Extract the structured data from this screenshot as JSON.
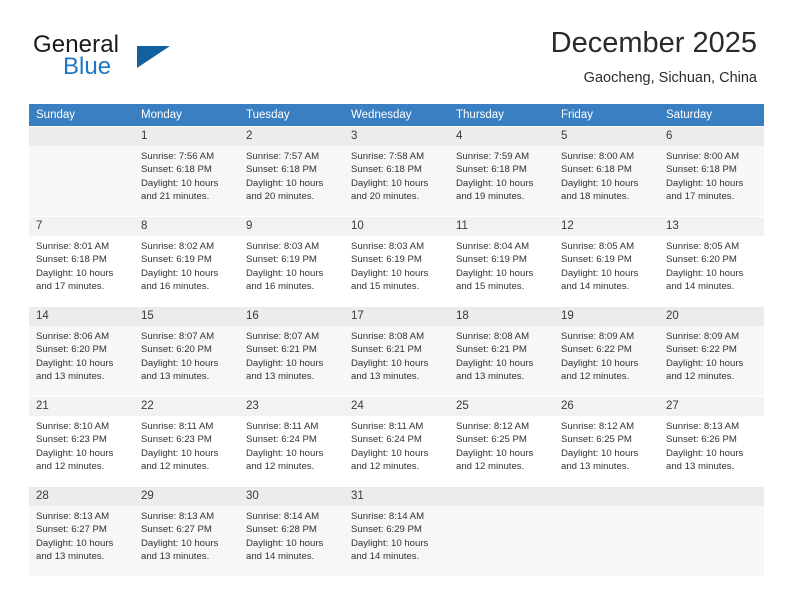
{
  "brand": {
    "name_part1": "General",
    "name_part2": "Blue",
    "logo_icon": "triangle-mark"
  },
  "header": {
    "title": "December 2025",
    "subtitle": "Gaocheng, Sichuan, China"
  },
  "weekdays": [
    "Sunday",
    "Monday",
    "Tuesday",
    "Wednesday",
    "Thursday",
    "Friday",
    "Saturday"
  ],
  "colors": {
    "header_blue": "#3a7fc1",
    "logo_blue": "#1f77c4",
    "daynum_bg": "#f2f2f2",
    "row_shade": "#f7f7f7",
    "text": "#333333"
  },
  "weeks": [
    [
      {
        "day": "",
        "detail": ""
      },
      {
        "day": "1",
        "detail": "Sunrise: 7:56 AM\nSunset: 6:18 PM\nDaylight: 10 hours\nand 21 minutes."
      },
      {
        "day": "2",
        "detail": "Sunrise: 7:57 AM\nSunset: 6:18 PM\nDaylight: 10 hours\nand 20 minutes."
      },
      {
        "day": "3",
        "detail": "Sunrise: 7:58 AM\nSunset: 6:18 PM\nDaylight: 10 hours\nand 20 minutes."
      },
      {
        "day": "4",
        "detail": "Sunrise: 7:59 AM\nSunset: 6:18 PM\nDaylight: 10 hours\nand 19 minutes."
      },
      {
        "day": "5",
        "detail": "Sunrise: 8:00 AM\nSunset: 6:18 PM\nDaylight: 10 hours\nand 18 minutes."
      },
      {
        "day": "6",
        "detail": "Sunrise: 8:00 AM\nSunset: 6:18 PM\nDaylight: 10 hours\nand 17 minutes."
      }
    ],
    [
      {
        "day": "7",
        "detail": "Sunrise: 8:01 AM\nSunset: 6:18 PM\nDaylight: 10 hours\nand 17 minutes."
      },
      {
        "day": "8",
        "detail": "Sunrise: 8:02 AM\nSunset: 6:19 PM\nDaylight: 10 hours\nand 16 minutes."
      },
      {
        "day": "9",
        "detail": "Sunrise: 8:03 AM\nSunset: 6:19 PM\nDaylight: 10 hours\nand 16 minutes."
      },
      {
        "day": "10",
        "detail": "Sunrise: 8:03 AM\nSunset: 6:19 PM\nDaylight: 10 hours\nand 15 minutes."
      },
      {
        "day": "11",
        "detail": "Sunrise: 8:04 AM\nSunset: 6:19 PM\nDaylight: 10 hours\nand 15 minutes."
      },
      {
        "day": "12",
        "detail": "Sunrise: 8:05 AM\nSunset: 6:19 PM\nDaylight: 10 hours\nand 14 minutes."
      },
      {
        "day": "13",
        "detail": "Sunrise: 8:05 AM\nSunset: 6:20 PM\nDaylight: 10 hours\nand 14 minutes."
      }
    ],
    [
      {
        "day": "14",
        "detail": "Sunrise: 8:06 AM\nSunset: 6:20 PM\nDaylight: 10 hours\nand 13 minutes."
      },
      {
        "day": "15",
        "detail": "Sunrise: 8:07 AM\nSunset: 6:20 PM\nDaylight: 10 hours\nand 13 minutes."
      },
      {
        "day": "16",
        "detail": "Sunrise: 8:07 AM\nSunset: 6:21 PM\nDaylight: 10 hours\nand 13 minutes."
      },
      {
        "day": "17",
        "detail": "Sunrise: 8:08 AM\nSunset: 6:21 PM\nDaylight: 10 hours\nand 13 minutes."
      },
      {
        "day": "18",
        "detail": "Sunrise: 8:08 AM\nSunset: 6:21 PM\nDaylight: 10 hours\nand 13 minutes."
      },
      {
        "day": "19",
        "detail": "Sunrise: 8:09 AM\nSunset: 6:22 PM\nDaylight: 10 hours\nand 12 minutes."
      },
      {
        "day": "20",
        "detail": "Sunrise: 8:09 AM\nSunset: 6:22 PM\nDaylight: 10 hours\nand 12 minutes."
      }
    ],
    [
      {
        "day": "21",
        "detail": "Sunrise: 8:10 AM\nSunset: 6:23 PM\nDaylight: 10 hours\nand 12 minutes."
      },
      {
        "day": "22",
        "detail": "Sunrise: 8:11 AM\nSunset: 6:23 PM\nDaylight: 10 hours\nand 12 minutes."
      },
      {
        "day": "23",
        "detail": "Sunrise: 8:11 AM\nSunset: 6:24 PM\nDaylight: 10 hours\nand 12 minutes."
      },
      {
        "day": "24",
        "detail": "Sunrise: 8:11 AM\nSunset: 6:24 PM\nDaylight: 10 hours\nand 12 minutes."
      },
      {
        "day": "25",
        "detail": "Sunrise: 8:12 AM\nSunset: 6:25 PM\nDaylight: 10 hours\nand 12 minutes."
      },
      {
        "day": "26",
        "detail": "Sunrise: 8:12 AM\nSunset: 6:25 PM\nDaylight: 10 hours\nand 13 minutes."
      },
      {
        "day": "27",
        "detail": "Sunrise: 8:13 AM\nSunset: 6:26 PM\nDaylight: 10 hours\nand 13 minutes."
      }
    ],
    [
      {
        "day": "28",
        "detail": "Sunrise: 8:13 AM\nSunset: 6:27 PM\nDaylight: 10 hours\nand 13 minutes."
      },
      {
        "day": "29",
        "detail": "Sunrise: 8:13 AM\nSunset: 6:27 PM\nDaylight: 10 hours\nand 13 minutes."
      },
      {
        "day": "30",
        "detail": "Sunrise: 8:14 AM\nSunset: 6:28 PM\nDaylight: 10 hours\nand 14 minutes."
      },
      {
        "day": "31",
        "detail": "Sunrise: 8:14 AM\nSunset: 6:29 PM\nDaylight: 10 hours\nand 14 minutes."
      },
      {
        "day": "",
        "detail": ""
      },
      {
        "day": "",
        "detail": ""
      },
      {
        "day": "",
        "detail": ""
      }
    ]
  ]
}
